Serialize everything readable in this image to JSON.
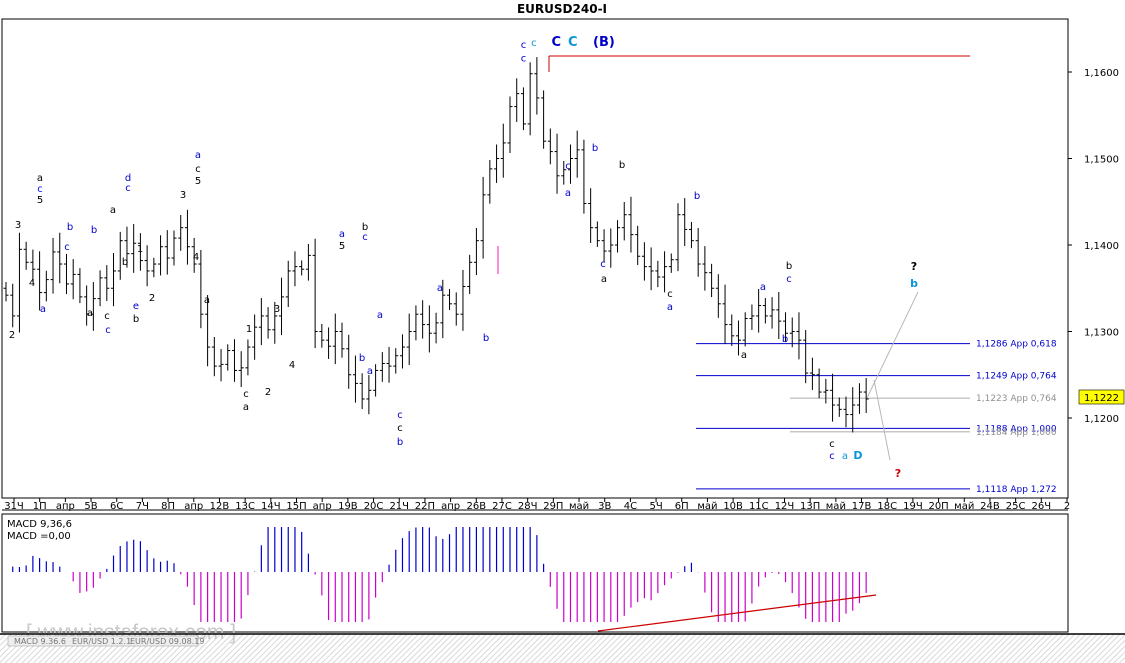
{
  "title": "EURUSD240-I",
  "price_tag": "1,1222",
  "macd": {
    "line1": "MACD 9,36,6",
    "line2": "MACD =0,00"
  },
  "watermark": "[ www.instaforex.com ]",
  "bottom_tabs": [
    "MACD 9.36.6",
    "EUR/USD 1.2.1",
    "EUR/USD 09.08.19"
  ],
  "colors": {
    "level": "#0000cd",
    "level_label": "#0000cd",
    "level_label_faint": "#909090",
    "macd_pos": "#0000cd",
    "macd_neg": "#cc00cc",
    "trend": "#cc0000",
    "price_box": "#ffff00"
  },
  "chart_data": {
    "type": "ohlc",
    "symbol": "EURUSD240-I",
    "y_ticks": [
      "1,1600",
      "1,1500",
      "1,1400",
      "1,1300",
      "1,1200"
    ],
    "ylim": [
      1.11,
      1.166
    ],
    "x_ticks": [
      "31Ч",
      "1П",
      "апр",
      "5В",
      "6С",
      "7Ч",
      "8П",
      "апр",
      "12В",
      "13С",
      "14Ч",
      "15П",
      "апр",
      "19В",
      "20С",
      "21Ч",
      "22П",
      "апр",
      "26В",
      "27С",
      "28Ч",
      "29П",
      "май",
      "3В",
      "4С",
      "5Ч",
      "6П",
      "май",
      "10В",
      "11С",
      "12Ч",
      "13П",
      "май",
      "17В",
      "18С",
      "19Ч",
      "20П",
      "май",
      "24В",
      "25С",
      "26Ч",
      "2"
    ],
    "close": [
      1.1342,
      1.1318,
      1.1395,
      1.138,
      1.1372,
      1.1345,
      1.136,
      1.1392,
      1.1378,
      1.1355,
      1.1366,
      1.134,
      1.132,
      1.1338,
      1.1362,
      1.135,
      1.137,
      1.1405,
      1.139,
      1.1402,
      1.1382,
      1.137,
      1.1378,
      1.1398,
      1.1385,
      1.1408,
      1.142,
      1.1398,
      1.1378,
      1.132,
      1.1282,
      1.126,
      1.1262,
      1.1278,
      1.1255,
      1.1258,
      1.1282,
      1.1305,
      1.1318,
      1.1302,
      1.1318,
      1.134,
      1.137,
      1.1375,
      1.1372,
      1.1388,
      1.13,
      1.129,
      1.1283,
      1.13,
      1.128,
      1.125,
      1.124,
      1.1222,
      1.1232,
      1.1255,
      1.1263,
      1.126,
      1.1272,
      1.1282,
      1.13,
      1.132,
      1.1308,
      1.1298,
      1.131,
      1.1342,
      1.1332,
      1.132,
      1.1352,
      1.138,
      1.1405,
      1.1458,
      1.1488,
      1.15,
      1.1518,
      1.156,
      1.1575,
      1.154,
      1.1598,
      1.157,
      1.152,
      1.1508,
      1.148,
      1.1487,
      1.15,
      1.151,
      1.1448,
      1.142,
      1.1405,
      1.1393,
      1.14,
      1.142,
      1.1435,
      1.1412,
      1.1387,
      1.1375,
      1.137,
      1.1363,
      1.1375,
      1.1383,
      1.1435,
      1.1418,
      1.1405,
      1.1378,
      1.1368,
      1.135,
      1.1332,
      1.1308,
      1.1295,
      1.129,
      1.1315,
      1.1318,
      1.133,
      1.1318,
      1.1325,
      1.1312,
      1.1298,
      1.13,
      1.129,
      1.1252,
      1.125,
      1.123,
      1.1232,
      1.1215,
      1.121,
      1.1204,
      1.1215,
      1.123,
      1.1222
    ],
    "annotations": [
      {
        "text": "c",
        "color": "blue",
        "price": 1.1628,
        "bar": 77
      },
      {
        "text": "c",
        "color": "blue",
        "price": 1.1612,
        "bar": 77
      },
      {
        "text": "c",
        "color": "cyan",
        "price": 1.163,
        "bar": 79
      },
      {
        "text": "C",
        "color": "blue",
        "price": 1.163,
        "bar": 81
      },
      {
        "text": "C",
        "color": "cyan",
        "price": 1.163,
        "bar": 83
      },
      {
        "text": "(B)",
        "color": "blue",
        "price": 1.163,
        "bar": 86
      },
      {
        "text": "1,1286 Арр 0,618",
        "color": "level",
        "price": 1.1286
      },
      {
        "text": "1,1249 Арр 0,764",
        "color": "level",
        "price": 1.1249
      },
      {
        "text": "1,1223 Арр 0,764",
        "color": "faint",
        "price": 1.1223
      },
      {
        "text": "1,1188 Арр 1,000",
        "color": "level",
        "price": 1.1188
      },
      {
        "text": "1,1184 Арр 1,000",
        "color": "faint",
        "price": 1.1184
      },
      {
        "text": "1,1118 Арр 1,272",
        "color": "level",
        "price": 1.1118
      }
    ]
  },
  "wave_labels": [
    [
      "3",
      "#000",
      18,
      228
    ],
    [
      "a",
      "#000",
      40,
      181
    ],
    [
      "c",
      "#000cff",
      40,
      192
    ],
    [
      "5",
      "#000",
      40,
      203
    ],
    [
      "4",
      "#000",
      32,
      286
    ],
    [
      "2",
      "#000",
      12,
      338
    ],
    [
      "b",
      "#0000cd",
      70,
      230
    ],
    [
      "a",
      "#0000cd",
      43,
      312
    ],
    [
      "c",
      "#0000cd",
      67,
      250
    ],
    [
      "a",
      "#000",
      90,
      316
    ],
    [
      "c",
      "#000",
      107,
      319
    ],
    [
      "c",
      "#0000cd",
      108,
      333
    ],
    [
      "b",
      "#0000cd",
      94,
      233
    ],
    [
      "d",
      "#0000cd",
      128,
      181
    ],
    [
      "c",
      "#0000cd",
      128,
      191
    ],
    [
      "a",
      "#000",
      113,
      213
    ],
    [
      "b",
      "#000",
      125,
      265
    ],
    [
      "1",
      "#000",
      140,
      252
    ],
    [
      "e",
      "#0000cd",
      136,
      309
    ],
    [
      "b",
      "#000",
      136,
      322
    ],
    [
      "2",
      "#000",
      152,
      301
    ],
    [
      "a",
      "#0000cd",
      198,
      158
    ],
    [
      "c",
      "#000",
      198,
      172
    ],
    [
      "5",
      "#000",
      198,
      184
    ],
    [
      "3",
      "#000",
      183,
      198
    ],
    [
      "4",
      "#000",
      196,
      260
    ],
    [
      "a",
      "#000",
      207,
      303
    ],
    [
      "1",
      "#000",
      249,
      332
    ],
    [
      "c",
      "#000",
      246,
      397
    ],
    [
      "a",
      "#000",
      246,
      410
    ],
    [
      "2",
      "#000",
      268,
      395
    ],
    [
      "3",
      "#000",
      277,
      312
    ],
    [
      "4",
      "#000",
      292,
      368
    ],
    [
      "a",
      "#0000cd",
      342,
      237
    ],
    [
      "5",
      "#000",
      342,
      249
    ],
    [
      "b",
      "#000",
      365,
      230
    ],
    [
      "c",
      "#0000cd",
      365,
      240
    ],
    [
      "b",
      "#0000cd",
      362,
      361
    ],
    [
      "a",
      "#0000cd",
      370,
      374
    ],
    [
      "a",
      "#0000cd",
      380,
      318
    ],
    [
      "c",
      "#0000cd",
      400,
      418
    ],
    [
      "c",
      "#000",
      400,
      431
    ],
    [
      "b",
      "#0000cd",
      400,
      445
    ],
    [
      "a",
      "#0000cd",
      440,
      291
    ],
    [
      "b",
      "#0000cd",
      486,
      341
    ],
    [
      "c",
      "#0000cd",
      568,
      169
    ],
    [
      "a",
      "#0000cd",
      568,
      196
    ],
    [
      "b",
      "#0000cd",
      595,
      151
    ],
    [
      "b",
      "#000",
      622,
      168
    ],
    [
      "c",
      "#0000cd",
      603,
      267
    ],
    [
      "a",
      "#000",
      604,
      282
    ],
    [
      "b",
      "#0000cd",
      697,
      199
    ],
    [
      "c",
      "#000",
      670,
      297
    ],
    [
      "a",
      "#0000cd",
      670,
      310
    ],
    [
      "b",
      "#000",
      789,
      269
    ],
    [
      "c",
      "#0000cd",
      789,
      282
    ],
    [
      "a",
      "#0000cd",
      763,
      290
    ],
    [
      "b",
      "#0000cd",
      785,
      342
    ],
    [
      "a",
      "#000",
      744,
      358
    ],
    [
      "c",
      "#000",
      832,
      447
    ],
    [
      "c",
      "#0000cd",
      832,
      459
    ],
    [
      "a",
      "#0896d8",
      845,
      459
    ]
  ],
  "big_labels": [
    [
      "D",
      "#0896d8",
      858,
      459
    ],
    [
      "?",
      "#000",
      914,
      270
    ],
    [
      "b",
      "#0896d8",
      914,
      287
    ],
    [
      "?",
      "#cc0000",
      898,
      477
    ]
  ]
}
